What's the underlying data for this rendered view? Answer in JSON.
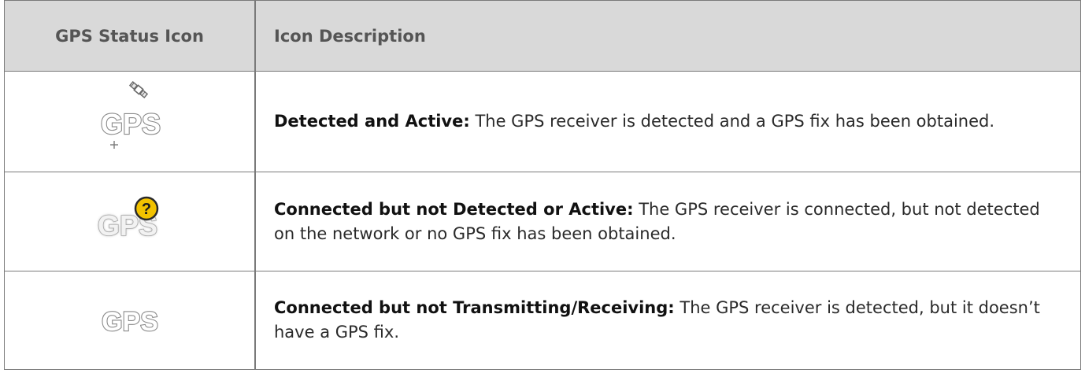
{
  "table": {
    "headers": {
      "icon_col": "GPS Status Icon",
      "desc_col": "Icon Description"
    },
    "rows": [
      {
        "icon": "gps-detected-active-icon",
        "icon_text": "GPS",
        "term": "Detected and Active:",
        "description": " The GPS receiver is detected and a GPS fix has been obtained."
      },
      {
        "icon": "gps-connected-not-detected-icon",
        "icon_text": "GPS",
        "badge": "?",
        "term": "Connected but not Detected or Active:",
        "description": " The GPS receiver is connected, but not detected on the network or no GPS fix has been obtained."
      },
      {
        "icon": "gps-connected-not-transmitting-icon",
        "icon_text": "GPS",
        "term": "Connected but not Transmitting/Receiving:",
        "description": " The GPS receiver is detected, but it doesn’t have a GPS fix."
      }
    ]
  },
  "colors": {
    "header_bg": "#d9d9d9",
    "border": "#7a7a7a",
    "badge_yellow": "#f2c200",
    "icon_white": "#ffffff",
    "icon_outline": "#8a8a8a"
  }
}
